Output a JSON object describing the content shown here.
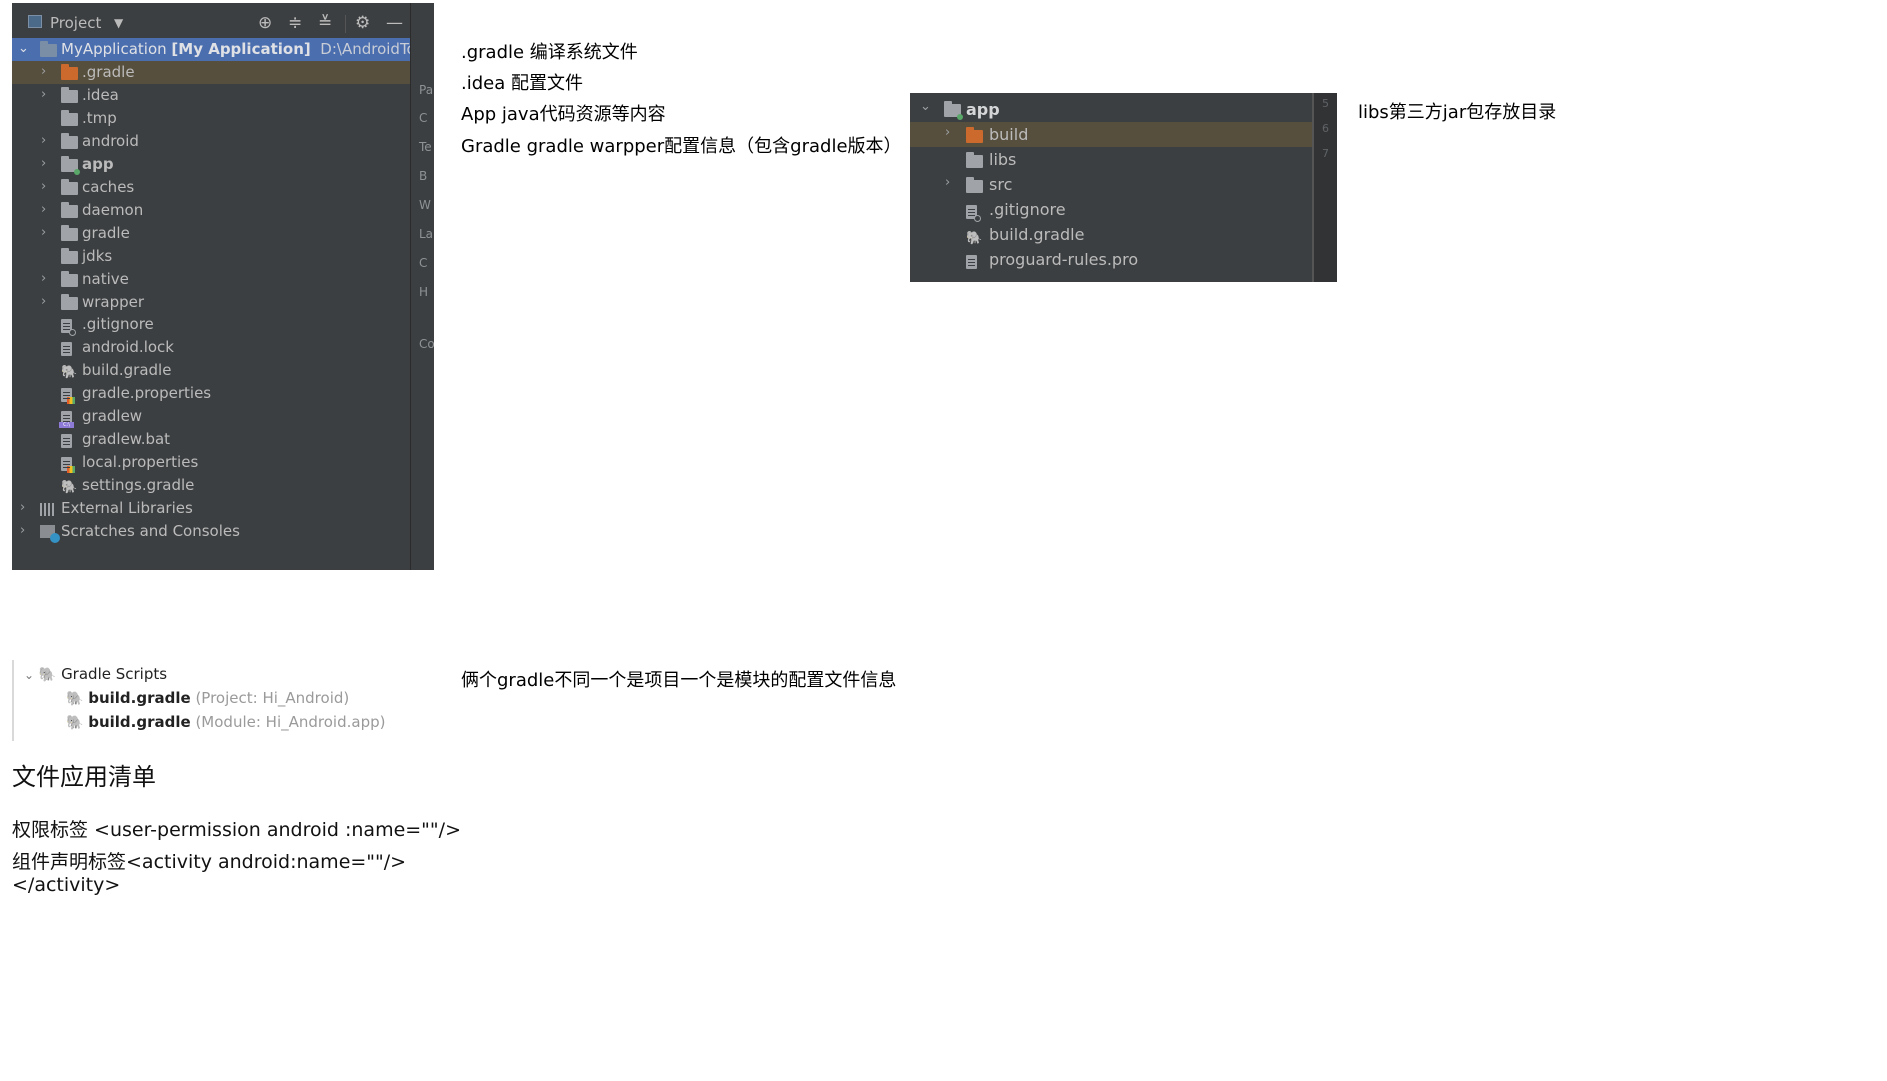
{
  "project_panel": {
    "header_title": "Project",
    "root": {
      "name": "MyApplication",
      "module": "[My Application]",
      "path": "D:\\AndroidTool\\An"
    },
    "items": [
      {
        "label": ".gradle",
        "expandable": true,
        "icon": "folder-orange-icon"
      },
      {
        "label": ".idea",
        "expandable": true,
        "icon": "folder-icon"
      },
      {
        "label": ".tmp",
        "expandable": false,
        "icon": "folder-icon"
      },
      {
        "label": "android",
        "expandable": true,
        "icon": "folder-icon"
      },
      {
        "label": "app",
        "expandable": true,
        "icon": "module-folder-icon"
      },
      {
        "label": "caches",
        "expandable": true,
        "icon": "folder-icon"
      },
      {
        "label": "daemon",
        "expandable": true,
        "icon": "folder-icon"
      },
      {
        "label": "gradle",
        "expandable": true,
        "icon": "folder-icon"
      },
      {
        "label": "jdks",
        "expandable": false,
        "icon": "folder-icon"
      },
      {
        "label": "native",
        "expandable": true,
        "icon": "folder-icon"
      },
      {
        "label": "wrapper",
        "expandable": true,
        "icon": "folder-icon"
      },
      {
        "label": ".gitignore",
        "expandable": false,
        "icon": "gitignore-file-icon"
      },
      {
        "label": "android.lock",
        "expandable": false,
        "icon": "text-file-icon"
      },
      {
        "label": "build.gradle",
        "expandable": false,
        "icon": "gradle-elephant-icon"
      },
      {
        "label": "gradle.properties",
        "expandable": false,
        "icon": "properties-file-icon"
      },
      {
        "label": "gradlew",
        "expandable": false,
        "icon": "shell-file-icon"
      },
      {
        "label": "gradlew.bat",
        "expandable": false,
        "icon": "text-file-icon"
      },
      {
        "label": "local.properties",
        "expandable": false,
        "icon": "properties-file-icon"
      },
      {
        "label": "settings.gradle",
        "expandable": false,
        "icon": "gradle-elephant-icon"
      }
    ],
    "external_libraries": "External Libraries",
    "scratches": "Scratches and Consoles",
    "side_strip": [
      "Pal",
      "C",
      "Te",
      "B",
      "W",
      "La",
      "C",
      "H",
      "Co"
    ]
  },
  "notes": {
    "gradle_note": ".gradle 编译系统文件",
    "idea_note": ".idea 配置文件",
    "app_note": "App java代码资源等内容",
    "gradle_dir_note": "Gradle gradle warpper配置信息（包含gradle版本）",
    "libs_note": "libs第三方jar包存放目录",
    "two_gradle_note": "俩个gradle不同一个是项目一个是模块的配置文件信息"
  },
  "app_panel": {
    "root": "app",
    "items": [
      {
        "label": "build",
        "expandable": true,
        "icon": "folder-orange-icon"
      },
      {
        "label": "libs",
        "expandable": false,
        "icon": "folder-icon"
      },
      {
        "label": "src",
        "expandable": true,
        "icon": "folder-icon"
      },
      {
        "label": ".gitignore",
        "expandable": false,
        "icon": "gitignore-file-icon"
      },
      {
        "label": "build.gradle",
        "expandable": false,
        "icon": "gradle-elephant-icon"
      },
      {
        "label": "proguard-rules.pro",
        "expandable": false,
        "icon": "text-file-icon"
      }
    ],
    "gutter_numbers": [
      "5",
      "6",
      "7"
    ]
  },
  "gradle_scripts": {
    "title": "Gradle Scripts",
    "items": [
      {
        "name": "build.gradle",
        "detail": "(Project: Hi_Android)"
      },
      {
        "name": "build.gradle",
        "detail": "(Module: Hi_Android.app)"
      }
    ]
  },
  "manifest": {
    "heading": "文件应用清单",
    "line1": "权限标签 <user-permission android :name=\"\"/>",
    "line2": "组件声明标签<activity android:name=\"\"/>",
    "line3": "</activity>"
  },
  "colors": {
    "panel_bg": "#3c3f41",
    "selection": "#4b6eaf",
    "highlight": "#574f3d",
    "folder_orange": "#cc6a2e"
  }
}
